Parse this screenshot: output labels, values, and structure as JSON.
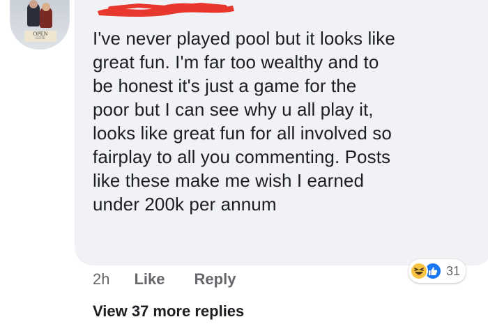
{
  "avatar": {
    "sign_text": "OPEN",
    "sign_sub": "SUITE"
  },
  "comment": {
    "author_redacted": true,
    "lines": [
      "I've never played pool but it looks like",
      "great fun. I'm far too wealthy and to",
      "be honest it's just a game for the",
      "poor but I can see why u all play it,",
      "looks like great fun for all involved so",
      "fairplay to all you commenting. Posts",
      "like these make me wish I earned",
      "under 200k per annum"
    ]
  },
  "reactions": {
    "icons": [
      "haha-icon",
      "like-icon"
    ],
    "count": "31"
  },
  "actions": {
    "time": "2h",
    "like_label": "Like",
    "reply_label": "Reply"
  },
  "replies": {
    "view_more_label": "View 37 more replies"
  },
  "colors": {
    "bubble_bg": "#f0f2f5",
    "text": "#1c1e21",
    "meta": "#65676b",
    "like_blue": "#1877f2",
    "haha_yellow": "#f7c444",
    "redaction_red": "#e8372c"
  }
}
